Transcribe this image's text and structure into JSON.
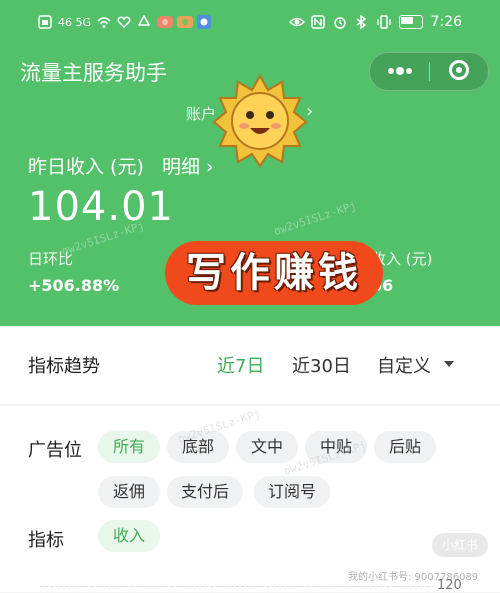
{
  "status_bar": {
    "signal_left": "46  5G",
    "time": "7:26"
  },
  "app": {
    "title": "流量主服务助手"
  },
  "account": {
    "label": "账户"
  },
  "income": {
    "label": "昨日收入 (元)",
    "detail_link": "明细",
    "amount": "104.01",
    "mom_label": "日环比",
    "mom_value": "+506.88%",
    "right_label": "收入 (元)",
    "right_value": "66"
  },
  "banner": {
    "text": "写作赚钱"
  },
  "trend": {
    "title": "指标趋势",
    "tabs": [
      "近7日",
      "近30日",
      "自定义"
    ],
    "active_tab": "近7日"
  },
  "filters": {
    "ad_slot_label": "广告位",
    "ad_slots": [
      "所有",
      "底部",
      "文中",
      "中贴",
      "后贴",
      "返佣",
      "支付后",
      "订阅号"
    ],
    "selected_ad_slot": "所有",
    "metric_label": "指标",
    "metrics": [
      "收入"
    ],
    "selected_metric": "收入"
  },
  "chart": {
    "y_top_tick": "120"
  },
  "watermarks": {
    "xhs_badge": "小红书",
    "xhs_id": "我的小红书号: 9007786089"
  },
  "colors": {
    "brand_green": "#52c16a",
    "active_green": "#3fae57",
    "banner_red": "#f04a1c"
  }
}
